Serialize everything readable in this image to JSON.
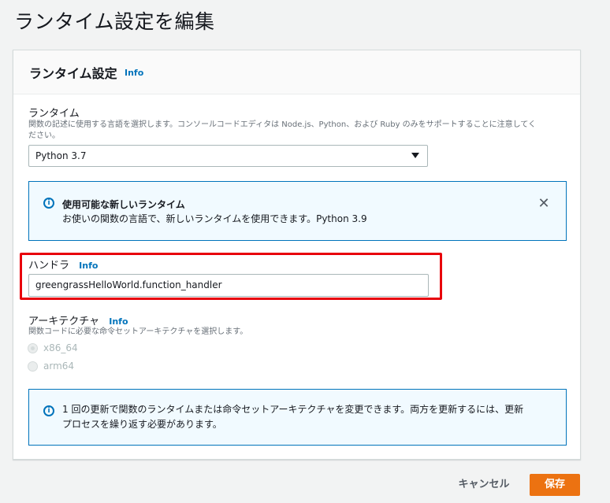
{
  "page": {
    "title": "ランタイム設定を編集"
  },
  "panel": {
    "title": "ランタイム設定",
    "info": "Info"
  },
  "runtime": {
    "label": "ランタイム",
    "description_line1": "関数の記述に使用する言語を選択します。コンソールコードエディタは Node.js、Python、および Ruby のみをサポートすることに注意してく",
    "description_line2": "ださい。",
    "selected": "Python 3.7"
  },
  "runtime_alert": {
    "title": "使用可能な新しいランタイム",
    "body": "お使いの関数の言語で、新しいランタイムを使用できます。Python 3.9"
  },
  "handler": {
    "label": "ハンドラ",
    "info": "Info",
    "value": "greengrassHelloWorld.function_handler"
  },
  "architecture": {
    "label": "アーキテクチャ",
    "info": "Info",
    "description": "関数コードに必要な命令セットアーキテクチャを選択します。",
    "options": [
      {
        "label": "x86_64",
        "checked": true
      },
      {
        "label": "arm64",
        "checked": false
      }
    ]
  },
  "arch_alert": {
    "line1": "1 回の更新で関数のランタイムまたは命令セットアーキテクチャを変更できます。両方を更新するには、更新",
    "line2": "プロセスを繰り返す必要があります。"
  },
  "footer": {
    "cancel": "キャンセル",
    "save": "保存"
  },
  "colors": {
    "accent": "#ec7211",
    "link": "#0073bb",
    "highlight": "#e8000b",
    "alert_bg": "#f1faff"
  }
}
